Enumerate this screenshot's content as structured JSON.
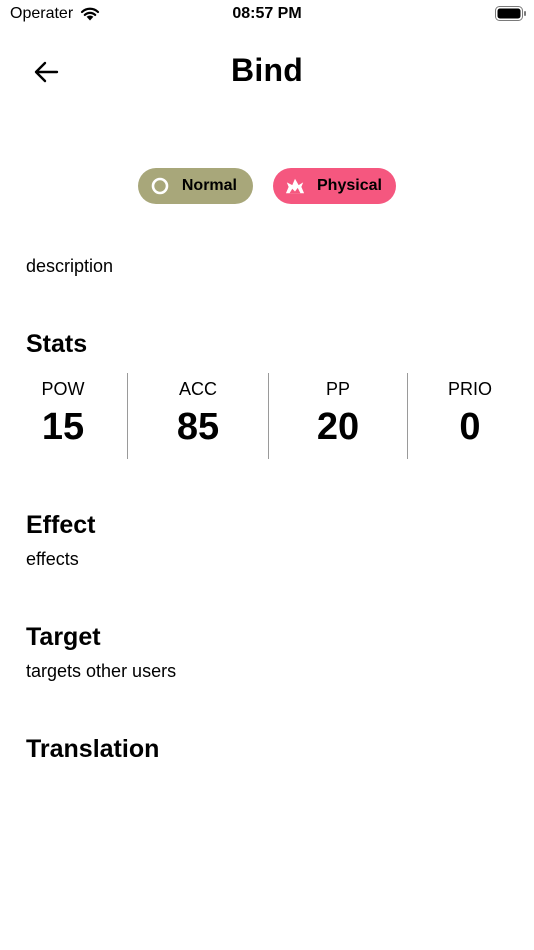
{
  "status_bar": {
    "carrier": "Operater",
    "time": "08:57 PM"
  },
  "nav": {
    "title": "Bind"
  },
  "chips": {
    "type_label": "Normal",
    "type_color": "#a8a77a",
    "category_label": "Physical",
    "category_color": "#f5577f"
  },
  "description": "description",
  "stats": {
    "title": "Stats",
    "items": [
      {
        "label": "POW",
        "value": "15"
      },
      {
        "label": "ACC",
        "value": "85"
      },
      {
        "label": "PP",
        "value": "20"
      },
      {
        "label": "PRIO",
        "value": "0"
      }
    ]
  },
  "effect": {
    "title": "Effect",
    "text": "effects"
  },
  "target": {
    "title": "Target",
    "text": "targets other users"
  },
  "translation": {
    "title": "Translation"
  }
}
